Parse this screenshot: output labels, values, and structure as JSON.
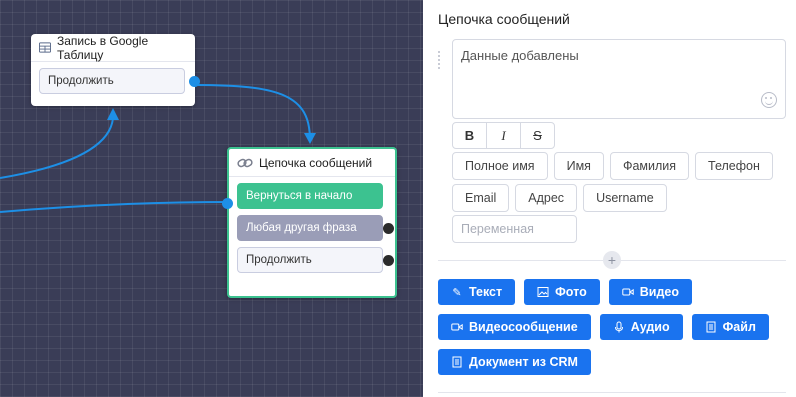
{
  "canvas": {
    "node1": {
      "title": "Запись в Google Таблицу",
      "icon": "table-icon",
      "ports": [
        "Продолжить"
      ]
    },
    "node2": {
      "title": "Цепочка сообщений",
      "icon": "link-icon",
      "ports": [
        "Вернуться в начало",
        "Любая другая фраза",
        "Продолжить"
      ]
    },
    "colors": {
      "wire": "#1d8fe6",
      "node_border_active": "#3cc290",
      "green_port": "#3cc290",
      "gray_port": "#9a9db7"
    }
  },
  "panel": {
    "title": "Цепочка сообщений",
    "message_text": "Данные добавлены",
    "format_buttons": [
      "B",
      "I",
      "S"
    ],
    "variables_row1": [
      "Полное имя",
      "Имя",
      "Фамилия",
      "Телефон"
    ],
    "variables_row2": [
      "Email",
      "Адрес",
      "Username"
    ],
    "variable_placeholder": "Переменная",
    "add_label": "+",
    "actions_row1": [
      {
        "label": "Текст",
        "icon": "pencil-icon"
      },
      {
        "label": "Фото",
        "icon": "image-icon"
      },
      {
        "label": "Видео",
        "icon": "video-icon"
      }
    ],
    "actions_row2": [
      {
        "label": "Видеосообщение",
        "icon": "video-icon"
      },
      {
        "label": "Аудио",
        "icon": "microphone-icon"
      },
      {
        "label": "Файл",
        "icon": "file-icon"
      }
    ],
    "actions_row3": [
      {
        "label": "Документ из CRM",
        "icon": "document-icon"
      }
    ],
    "accent": "#1a73ef"
  }
}
